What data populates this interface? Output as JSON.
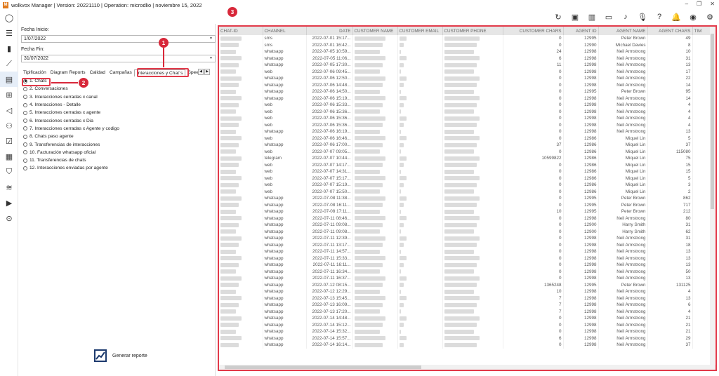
{
  "window": {
    "title": "wolkvox Manager  | Version: 20221110  |  Operation: microdlio  |  noviembre 15, 2022"
  },
  "filters": {
    "start_label": "Fecha Inicio:",
    "start_value": "1/07/2022",
    "end_label": "Fecha Fin:",
    "end_value": "31/07/2022"
  },
  "tabs": [
    "Tipificación",
    "Diagram Reports",
    "Calidad",
    "Campañas",
    "Interacciones y Chat´s",
    "Spee"
  ],
  "reports": [
    "1. Chats",
    "2. Conversaciones",
    "3. Interacciones cerradas x canal",
    "4. Interacciones - Detalle",
    "5. Interacciones cerradas x agente",
    "6. Interacciones cerradas x Dia",
    "7. Interacciones cerradas x Agente y codigo",
    "8. Chats paso agente",
    "9. Transferencias de interacciones",
    "10. Facturación whatsapp oficial",
    "11. Transferencias de chats",
    "12. Interacciones enviadas por agente"
  ],
  "generate_label": "Generar reporte",
  "annotations": {
    "b1": "1",
    "b2": "2",
    "b3": "3"
  },
  "colors": {
    "highlight": "#e23a4a",
    "badge": "#d8283a"
  },
  "columns": [
    "CHAT-ID",
    "CHANNEL",
    "DATE",
    "CUSTOMER NAME",
    "CUSTOMER EMAIL",
    "CUSTOMER PHONE",
    "CUSTOMER CHARS",
    "AGENT ID",
    "AGENT NAME",
    "AGENT CHARS",
    "TIM"
  ],
  "rows": [
    [
      "sms",
      "2022-07-01 15:17...",
      "0",
      "12995",
      "Peter Brown",
      "49"
    ],
    [
      "sms",
      "2022-07-01 16:42...",
      "0",
      "12990",
      "Michael Davies",
      "8"
    ],
    [
      "whatsapp",
      "2022-07-05 10:59...",
      "24",
      "12998",
      "Neil Armstrong",
      "10"
    ],
    [
      "whatsapp",
      "2022-07-05 11:06...",
      "6",
      "12998",
      "Neil Armstrong",
      "31"
    ],
    [
      "whatsapp",
      "2022-07-05 17:30...",
      "11",
      "12998",
      "Neil Armstrong",
      "13"
    ],
    [
      "web",
      "2022-07-06 09:45...",
      "0",
      "12998",
      "Neil Armstrong",
      "17"
    ],
    [
      "whatsapp",
      "2022-07-06 12:50...",
      "0",
      "12998",
      "Neil Armstrong",
      "22"
    ],
    [
      "whatsapp",
      "2022-07-06 14:48...",
      "0",
      "12998",
      "Neil Armstrong",
      "14"
    ],
    [
      "whatsapp",
      "2022-07-06 14:50...",
      "0",
      "12995",
      "Peter Brown",
      "95"
    ],
    [
      "whatsapp",
      "2022-07-06 15:19...",
      "0",
      "12998",
      "Neil Armstrong",
      "14"
    ],
    [
      "web",
      "2022-07-06 15:33...",
      "0",
      "12998",
      "Neil Armstrong",
      "4"
    ],
    [
      "web",
      "2022-07-06 15:36...",
      "0",
      "12998",
      "Neil Armstrong",
      "4"
    ],
    [
      "web",
      "2022-07-06 15:36...",
      "0",
      "12998",
      "Neil Armstrong",
      "4"
    ],
    [
      "web",
      "2022-07-06 15:36...",
      "0",
      "12998",
      "Neil Armstrong",
      "4"
    ],
    [
      "whatsapp",
      "2022-07-06 16:19...",
      "0",
      "12998",
      "Neil Armstrong",
      "13"
    ],
    [
      "web",
      "2022-07-06 16:46...",
      "0",
      "12986",
      "Miquel Lin",
      "5"
    ],
    [
      "whatsapp",
      "2022-07-06 17:00...",
      "37",
      "12986",
      "Miquel Lin",
      "37"
    ],
    [
      "web",
      "2022-07-07 09:05...",
      "0",
      "12986",
      "Miquel Lin",
      "115080"
    ],
    [
      "telegram",
      "2022-07-07 10:44...",
      "10599822",
      "12986",
      "Miquel Lin",
      "75"
    ],
    [
      "web",
      "2022-07-07 14:17...",
      "0",
      "12986",
      "Miquel Lin",
      "15"
    ],
    [
      "web",
      "2022-07-07 14:31...",
      "0",
      "12986",
      "Miquel Lin",
      "15"
    ],
    [
      "web",
      "2022-07-07 15:17...",
      "0",
      "12986",
      "Miquel Lin",
      "5"
    ],
    [
      "web",
      "2022-07-07 15:19...",
      "0",
      "12986",
      "Miquel Lin",
      "3"
    ],
    [
      "web",
      "2022-07-07 15:50...",
      "0",
      "12986",
      "Miquel Lin",
      "2"
    ],
    [
      "whatsapp",
      "2022-07-08 11:38...",
      "0",
      "12995",
      "Peter Brown",
      "862"
    ],
    [
      "whatsapp",
      "2022-07-08 16:11...",
      "0",
      "12995",
      "Peter Brown",
      "717"
    ],
    [
      "whatsapp",
      "2022-07-08 17:11...",
      "10",
      "12995",
      "Peter Brown",
      "212"
    ],
    [
      "whatsapp",
      "2022-07-11 08:46...",
      "0",
      "12998",
      "Neil Armstrong",
      "80"
    ],
    [
      "whatsapp",
      "2022-07-11 09:08...",
      "0",
      "12900",
      "Harry Smith",
      "31"
    ],
    [
      "whatsapp",
      "2022-07-11 09:08...",
      "0",
      "12900",
      "Harry Smith",
      "62"
    ],
    [
      "whatsapp",
      "2022-07-11 12:39...",
      "0",
      "12998",
      "Neil Armstrong",
      "31"
    ],
    [
      "whatsapp",
      "2022-07-11 13:17...",
      "0",
      "12998",
      "Neil Armstrong",
      "18"
    ],
    [
      "whatsapp",
      "2022-07-11 14:57...",
      "0",
      "12998",
      "Neil Armstrong",
      "13"
    ],
    [
      "whatsapp",
      "2022-07-11 15:33...",
      "0",
      "12998",
      "Neil Armstrong",
      "13"
    ],
    [
      "whatsapp",
      "2022-07-11 16:11...",
      "0",
      "12998",
      "Neil Armstrong",
      "13"
    ],
    [
      "whatsapp",
      "2022-07-11 16:34...",
      "0",
      "12998",
      "Neil Armstrong",
      "50"
    ],
    [
      "whatsapp",
      "2022-07-11 16:37...",
      "0",
      "12998",
      "Neil Armstrong",
      "13"
    ],
    [
      "whatsapp",
      "2022-07-12 08:15...",
      "1365248",
      "12995",
      "Peter Brown",
      "131125"
    ],
    [
      "whatsapp",
      "2022-07-12 12:29...",
      "10",
      "12998",
      "Neil Armstrong",
      "4"
    ],
    [
      "whatsapp",
      "2022-07-13 15:45...",
      "7",
      "12998",
      "Neil Armstrong",
      "13"
    ],
    [
      "whatsapp",
      "2022-07-13 16:09...",
      "7",
      "12998",
      "Neil Armstrong",
      "6"
    ],
    [
      "whatsapp",
      "2022-07-13 17:20...",
      "7",
      "12998",
      "Neil Armstrong",
      "4"
    ],
    [
      "whatsapp",
      "2022-07-14 14:48...",
      "0",
      "12998",
      "Neil Armstrong",
      "21"
    ],
    [
      "whatsapp",
      "2022-07-14 15:12...",
      "0",
      "12998",
      "Neil Armstrong",
      "21"
    ],
    [
      "whatsapp",
      "2022-07-14 15:32...",
      "0",
      "12998",
      "Neil Armstrong",
      "21"
    ],
    [
      "whatsapp",
      "2022-07-14 15:57...",
      "6",
      "12998",
      "Neil Armstrong",
      "29"
    ],
    [
      "whatsapp",
      "2022-07-14 16:14...",
      "0",
      "12998",
      "Neil Armstrong",
      "37"
    ]
  ]
}
